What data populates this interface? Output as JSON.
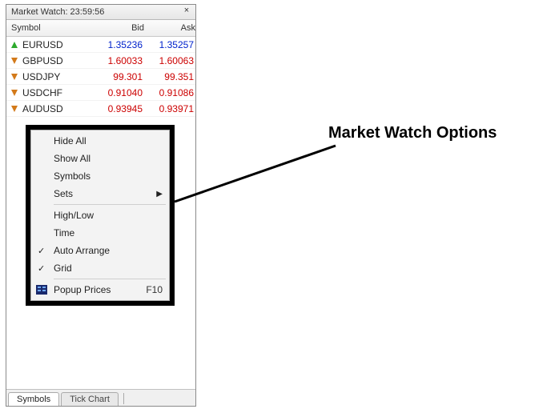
{
  "title": "Market Watch: 23:59:56",
  "columns": {
    "symbol": "Symbol",
    "bid": "Bid",
    "ask": "Ask"
  },
  "instruments": [
    {
      "symbol": "EURUSD",
      "bid": "1.35236",
      "ask": "1.35257",
      "dir": "up"
    },
    {
      "symbol": "GBPUSD",
      "bid": "1.60033",
      "ask": "1.60063",
      "dir": "down"
    },
    {
      "symbol": "USDJPY",
      "bid": "99.301",
      "ask": "99.351",
      "dir": "down"
    },
    {
      "symbol": "USDCHF",
      "bid": "0.91040",
      "ask": "0.91086",
      "dir": "down"
    },
    {
      "symbol": "AUDUSD",
      "bid": "0.93945",
      "ask": "0.93971",
      "dir": "down"
    }
  ],
  "context_menu": {
    "hide_all": "Hide All",
    "show_all": "Show All",
    "symbols": "Symbols",
    "sets": "Sets",
    "high_low": "High/Low",
    "time": "Time",
    "auto_arrange": "Auto Arrange",
    "grid": "Grid",
    "popup_prices": "Popup Prices",
    "popup_shortcut": "F10"
  },
  "tabs": {
    "symbols": "Symbols",
    "tick_chart": "Tick Chart"
  },
  "annotation": "Market Watch Options",
  "colors": {
    "up": "#0022cc",
    "down": "#cc0000"
  }
}
